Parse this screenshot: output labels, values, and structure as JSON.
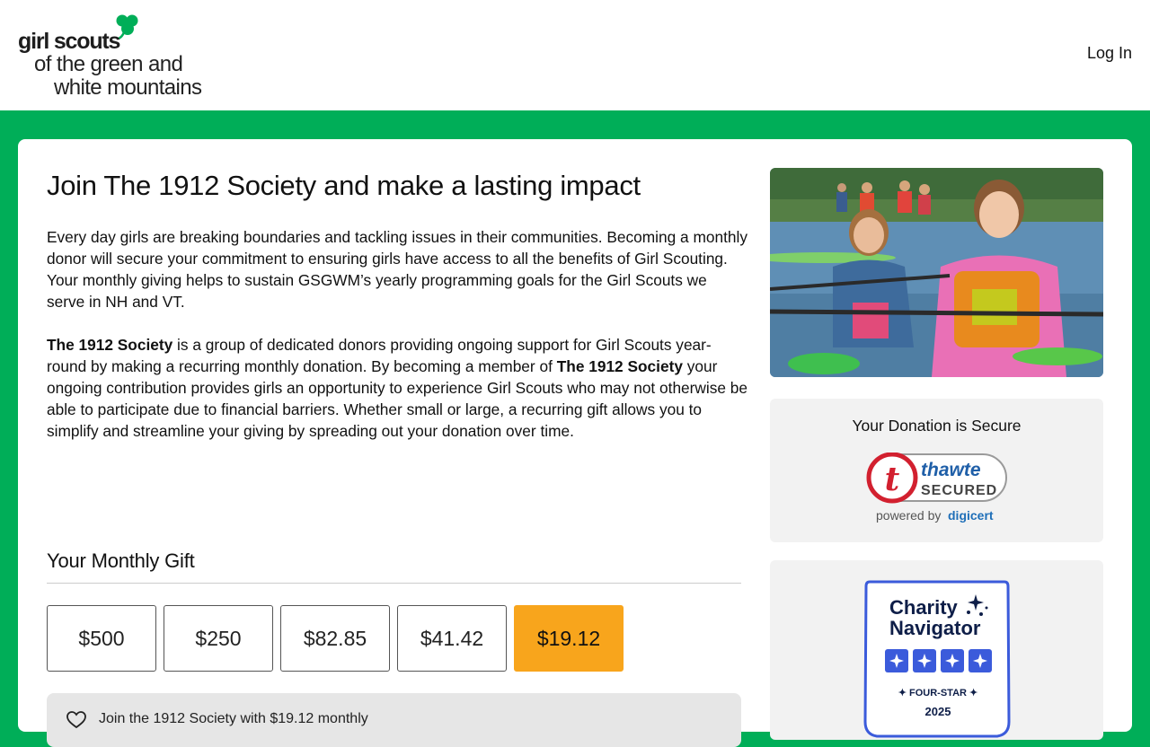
{
  "header": {
    "logo": {
      "line1": "girl scouts",
      "line2": "of the green and",
      "line3": "white mountains"
    },
    "login_label": "Log In"
  },
  "main": {
    "title": "Join The 1912 Society and make a lasting impact",
    "intro": "Every day girls are breaking boundaries and tackling issues in their communities.  Becoming a monthly donor will secure your commitment to ensuring girls have access to all the benefits of Girl Scouting. Your monthly giving helps to sustain GSGWM’s yearly programming goals for the Girl Scouts we serve in NH and VT.",
    "society": {
      "name": "The 1912 Society",
      "text1": " is a group of dedicated donors providing ongoing support for Girl Scouts year-round by making a recurring monthly donation.  By becoming a member of ",
      "name2": "The 1912 Society",
      "text2": " your ongoing contribution provides girls an opportunity to experience Girl Scouts who may not otherwise be able to participate due to financial barriers. Whether small or large, a recurring gift allows you to simplify and streamline your giving by spreading out your donation over time."
    }
  },
  "gift": {
    "title": "Your Monthly Gift",
    "amounts": [
      "$500",
      "$250",
      "$82.85",
      "$41.42",
      "$19.12"
    ],
    "selected": "$19.12",
    "recurring_text": "Join the 1912 Society with $19.12 monthly"
  },
  "sidebar": {
    "secure_title": "Your Donation is Secure",
    "thawte": {
      "brand": "thawte",
      "secured": "SECURED",
      "powered": "powered by",
      "digicert": "digicert"
    },
    "charity_navigator": {
      "line1": "Charity",
      "line2": "Navigator",
      "rating": "FOUR-STAR",
      "year": "2025"
    }
  },
  "colors": {
    "brand_green": "#00ae58",
    "selected_amount": "#f8a51c",
    "panel": "#f2f2f2",
    "thawte_red": "#d2202f",
    "cn_blue": "#3b5bdb"
  }
}
